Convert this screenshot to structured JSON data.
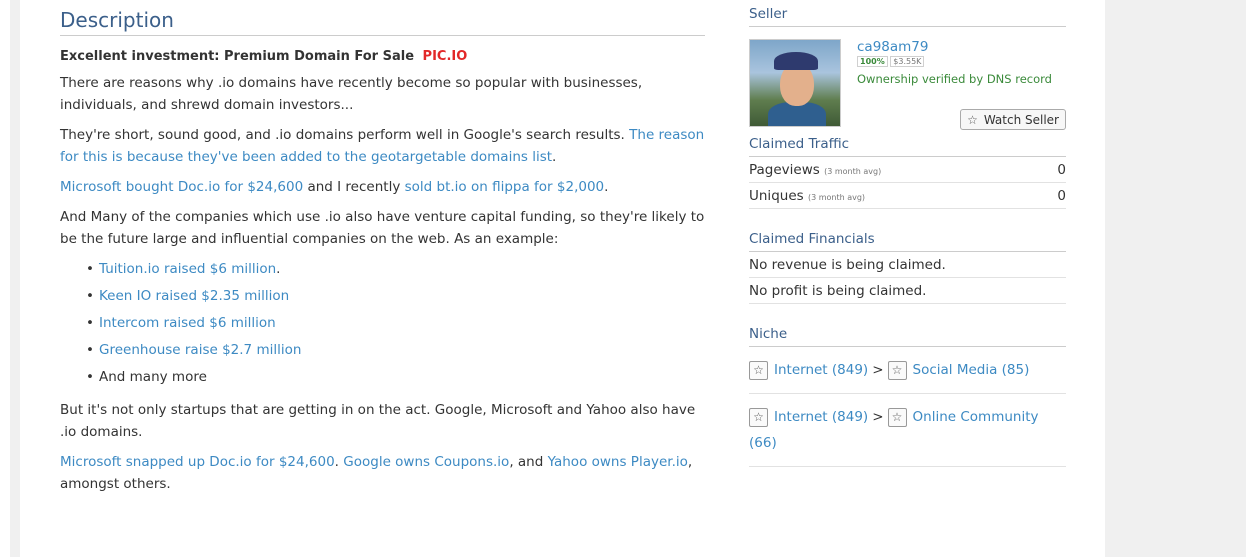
{
  "description": {
    "title": "Description",
    "headline": "Excellent investment: Premium Domain For Sale",
    "brand": "PIC.IO",
    "p1": "There are reasons why .io domains have recently become so popular with businesses, individuals, and shrewd domain investors...",
    "p2_text": "They're short, sound good, and .io domains perform well in Google's search results.",
    "p2_link": "The reason for this is because they've been added to the geotargetable domains list",
    "p2_end": ".",
    "p3_link1": "Microsoft bought Doc.io for $24,600",
    "p3_mid": "and I recently",
    "p3_link2": "sold bt.io on flippa for $2,000",
    "p3_end": ".",
    "p4": "And Many of the companies which use .io also have venture capital funding, so they're likely to be the future large and influential companies on the web. As an example:",
    "list": [
      {
        "link": "Tuition.io raised $6 million",
        "suffix": "."
      },
      {
        "link": "Keen IO raised $2.35 million",
        "suffix": ""
      },
      {
        "link": "Intercom raised $6 million",
        "suffix": ""
      },
      {
        "link": "Greenhouse raise $2.7 million",
        "suffix": ""
      }
    ],
    "list_last": "And many more",
    "p5": "But it's not only startups that are getting in on the act. Google, Microsoft and Yahoo also have .io domains.",
    "p6_link1": "Microsoft snapped up Doc.io for $24,600",
    "p6_sep1": ".",
    "p6_link2": "Google owns Coupons.io",
    "p6_sep2": ", and",
    "p6_link3": "Yahoo owns Player.io",
    "p6_end": ", amongst others."
  },
  "seller": {
    "section_title": "Seller",
    "name": "ca98am79",
    "rating": "100%",
    "amount": "$3.55K",
    "verified": "Ownership verified by DNS record",
    "watch_label": "Watch Seller",
    "watch_icon": "star-icon"
  },
  "traffic": {
    "section_title": "Claimed Traffic",
    "rows": [
      {
        "label": "Pageviews",
        "note": "(3 month avg)",
        "value": "0"
      },
      {
        "label": "Uniques",
        "note": "(3 month avg)",
        "value": "0"
      }
    ]
  },
  "financials": {
    "section_title": "Claimed Financials",
    "revenue": "No revenue is being claimed.",
    "profit": "No profit is being claimed."
  },
  "niche": {
    "section_title": "Niche",
    "items": [
      {
        "parent": "Internet (849)",
        "child": "Social Media (85)"
      },
      {
        "parent": "Internet (849)",
        "child": "Online Community (66)"
      }
    ]
  },
  "colors": {
    "link": "#3d8ac3",
    "heading": "#3b5f8a",
    "brand": "#e22828",
    "verified": "#3a8a3a"
  }
}
